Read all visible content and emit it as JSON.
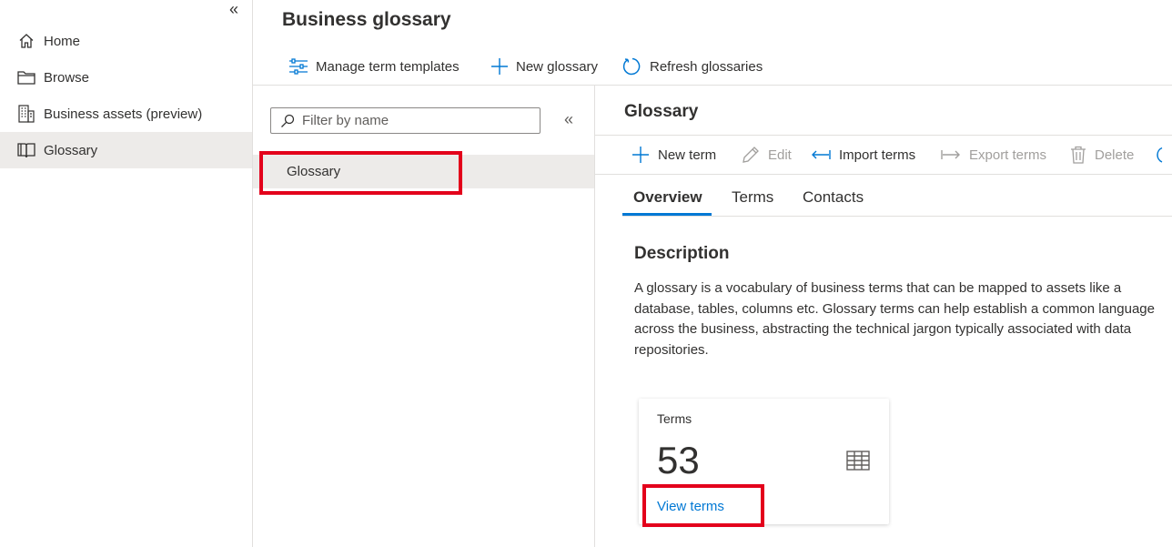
{
  "nav": {
    "collapse_glyph": "«",
    "items": [
      {
        "label": "Home",
        "icon": "home-icon"
      },
      {
        "label": "Browse",
        "icon": "folder-icon"
      },
      {
        "label": "Business assets (preview)",
        "icon": "building-icon"
      },
      {
        "label": "Glossary",
        "icon": "book-icon",
        "active": true
      }
    ]
  },
  "header": {
    "title": "Business glossary",
    "commands": [
      {
        "label": "Manage term templates",
        "icon": "sliders-icon"
      },
      {
        "label": "New glossary",
        "icon": "plus-icon"
      },
      {
        "label": "Refresh glossaries",
        "icon": "refresh-icon"
      }
    ]
  },
  "tree": {
    "filter_placeholder": "Filter by name",
    "collapse_glyph": "«",
    "items": [
      {
        "label": "Glossary",
        "selected": true
      }
    ]
  },
  "detail": {
    "title": "Glossary",
    "commands": [
      {
        "label": "New term",
        "icon": "plus-icon",
        "enabled": true
      },
      {
        "label": "Edit",
        "icon": "pencil-icon",
        "enabled": false
      },
      {
        "label": "Import terms",
        "icon": "import-icon",
        "enabled": true
      },
      {
        "label": "Export terms",
        "icon": "export-icon",
        "enabled": false
      },
      {
        "label": "Delete",
        "icon": "trash-icon",
        "enabled": false
      }
    ],
    "tabs": [
      {
        "label": "Overview",
        "active": true
      },
      {
        "label": "Terms"
      },
      {
        "label": "Contacts"
      }
    ],
    "description_heading": "Description",
    "description_text": "A glossary is a vocabulary of business terms that can be mapped to assets like a database, tables, columns etc. Glossary terms can help establish a common language across the business, abstracting the technical jargon typically associated with data repositories.",
    "card": {
      "label": "Terms",
      "count": "53",
      "link": "View terms",
      "icon": "table-icon"
    }
  },
  "colors": {
    "accent": "#0078d4",
    "highlight_box": "#e3001b",
    "selected_bg": "#edebe9",
    "disabled_text": "#a19f9d"
  }
}
